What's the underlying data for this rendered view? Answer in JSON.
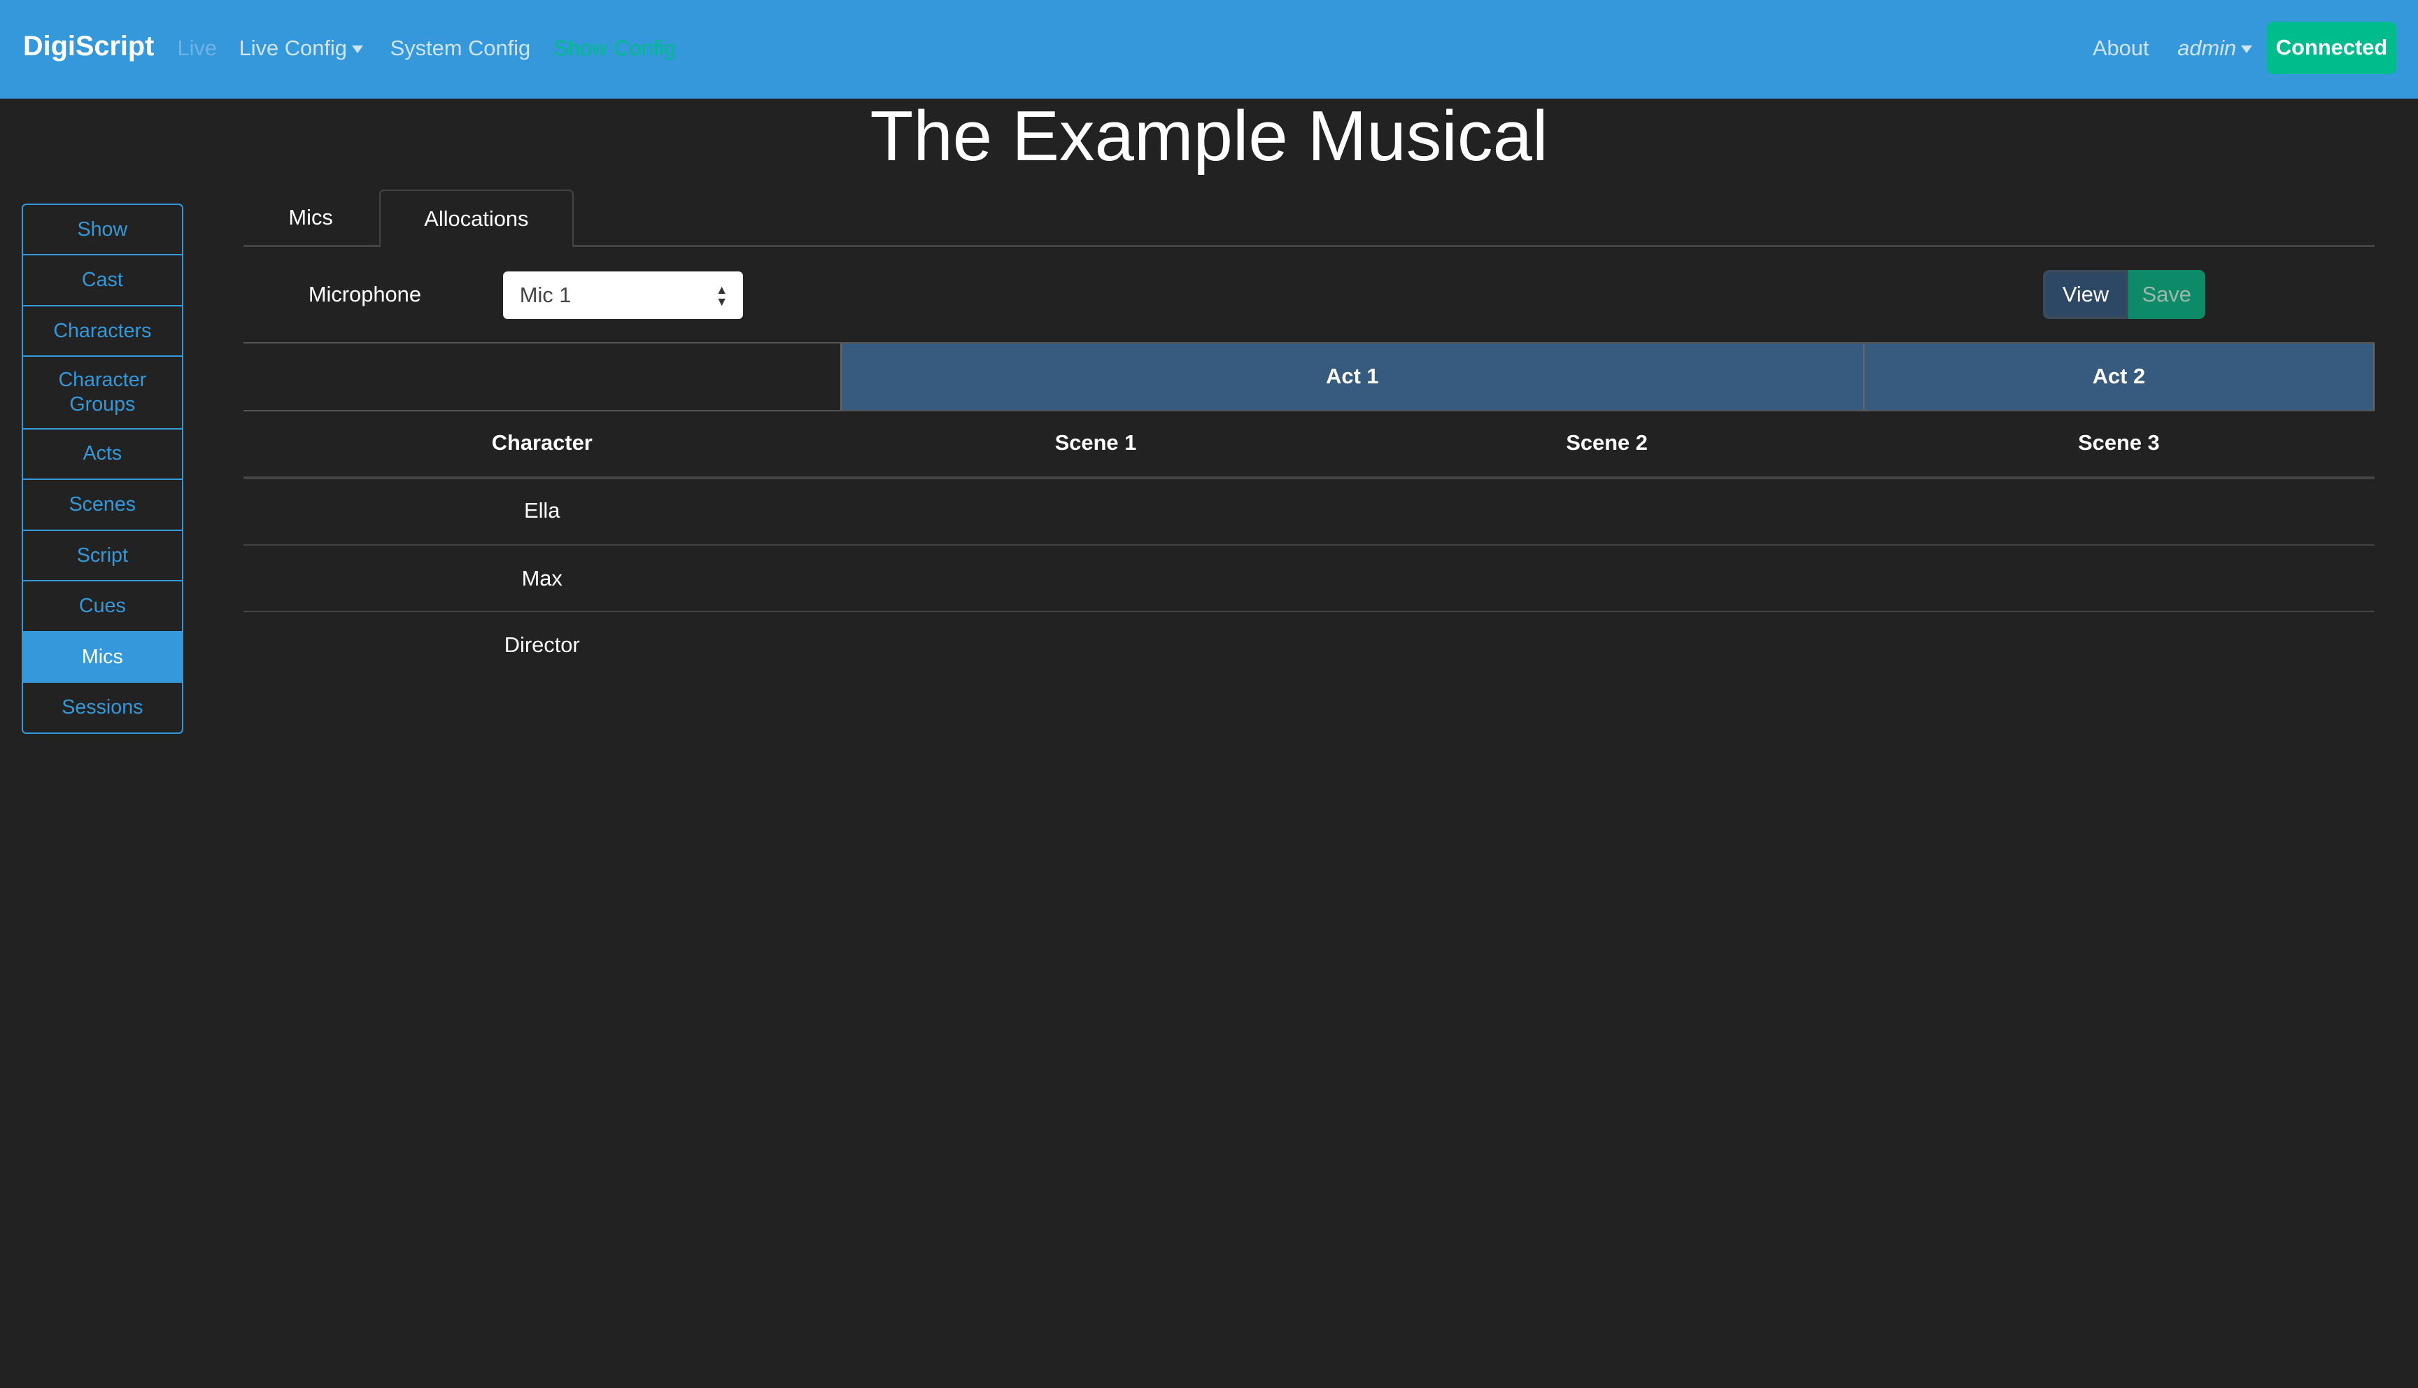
{
  "navbar": {
    "brand": "DigiScript",
    "links": [
      "Live",
      "Live Config",
      "System Config",
      "Show Config"
    ],
    "about": "About",
    "user": "admin",
    "status": "Connected"
  },
  "colors": {
    "primary": "#3498db",
    "success": "#00bc8c",
    "act_header": "#375a7f",
    "background": "#222222"
  },
  "page_title": "The Example Musical",
  "sidebar": {
    "items": [
      "Show",
      "Cast",
      "Characters",
      "Character Groups",
      "Acts",
      "Scenes",
      "Script",
      "Cues",
      "Mics",
      "Sessions"
    ],
    "active": "Mics"
  },
  "tabs": [
    "Mics",
    "Allocations"
  ],
  "active_tab": "Allocations",
  "microphone": {
    "label": "Microphone",
    "value": "Mic 1"
  },
  "buttons": {
    "view": "View",
    "save": "Save"
  },
  "table": {
    "acts": [
      "Act 1",
      "Act 2"
    ],
    "headers": [
      "Character",
      "Scene 1",
      "Scene 2",
      "Scene 3"
    ],
    "rows": [
      "Ella",
      "Max",
      "Director"
    ]
  }
}
